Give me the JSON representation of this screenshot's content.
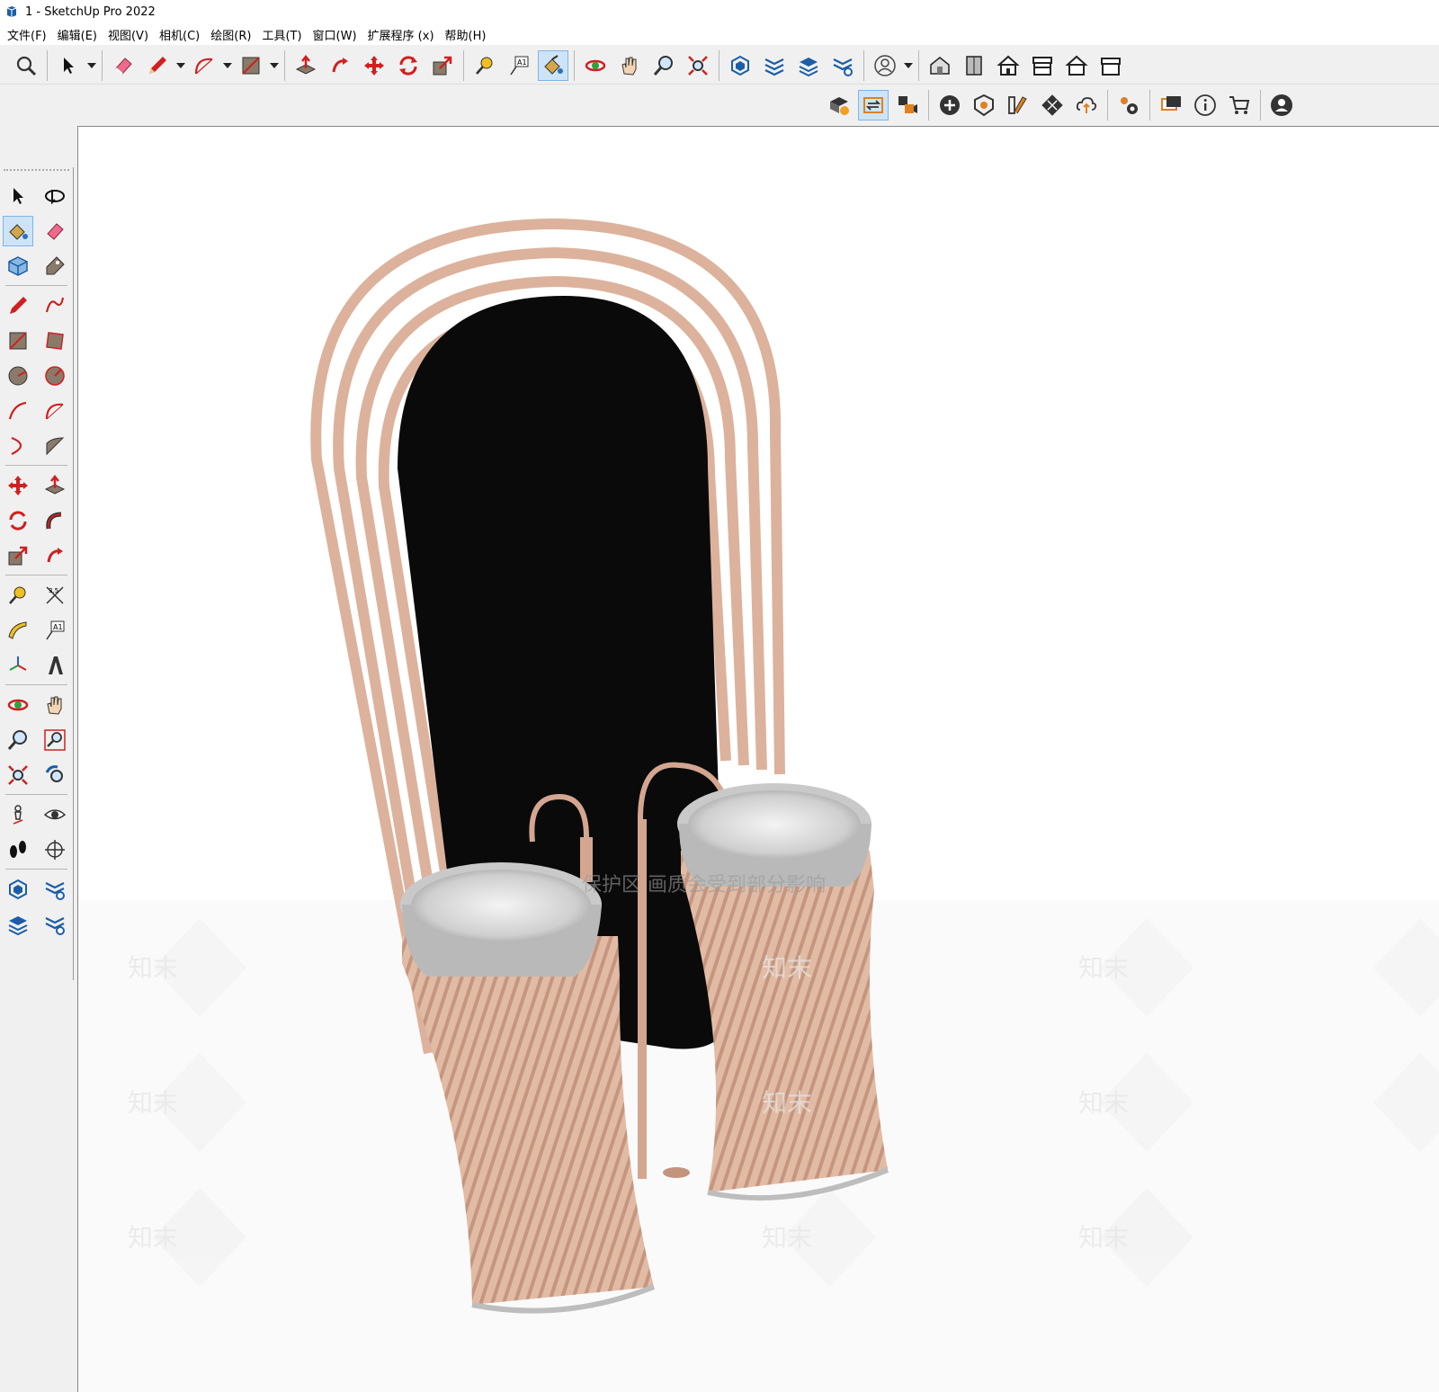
{
  "window": {
    "title": "1 - SketchUp Pro 2022"
  },
  "menu": [
    "文件(F)",
    "编辑(E)",
    "视图(V)",
    "相机(C)",
    "绘图(R)",
    "工具(T)",
    "窗口(W)",
    "扩展程序 (x)",
    "帮助(H)"
  ],
  "colors": {
    "accent": "#cde4f7",
    "model_rose": "#e0b8a2",
    "model_rose_dark": "#c4937c",
    "mirror": "#0a0a0a",
    "marble": "#d8d8d8"
  },
  "toolbar_top_icons": [
    "zoom-icon",
    "select-icon",
    "eraser-icon",
    "pencil-icon",
    "arc-icon",
    "rectangle-icon",
    "push-pull-icon",
    "follow-me-icon",
    "move-icon",
    "rotate-icon",
    "scale-icon",
    "tape-measure-icon",
    "text-icon",
    "paint-bucket-icon",
    "orbit-icon",
    "pan-icon",
    "zoom-tool-icon",
    "zoom-extents-icon",
    "warehouse-icon",
    "extension-warehouse-icon",
    "layer-icon",
    "settings-icon",
    "account-icon",
    "iso-view-icon",
    "top-view-icon",
    "front-view-icon",
    "right-view-icon",
    "back-view-icon",
    "left-view-icon"
  ],
  "toolbar_second_icons": [
    "section-icon",
    "transfer-icon",
    "video-icon",
    "add-icon",
    "style-icon",
    "materials-icon",
    "checker-icon",
    "cloud-icon",
    "gears-icon",
    "chat-icon",
    "info-icon",
    "cart-icon",
    "user-icon"
  ],
  "left_toolbar_icons": [
    [
      "select-icon",
      "orbit-icon"
    ],
    [
      "paint-bucket-icon",
      "eraser-icon"
    ],
    [
      "component-icon",
      "tag-icon"
    ],
    [
      "pencil-icon",
      "freehand-icon"
    ],
    [
      "rectangle-icon",
      "rotated-rectangle-icon"
    ],
    [
      "circle-icon",
      "polygon-icon"
    ],
    [
      "arc-icon",
      "two-point-arc-icon"
    ],
    [
      "three-point-arc-icon",
      "pie-icon"
    ],
    [
      "move-icon",
      "push-pull-icon"
    ],
    [
      "rotate-icon",
      "follow-me-icon"
    ],
    [
      "scale-icon",
      "offset-icon"
    ],
    [
      "tape-measure-icon",
      "dimension-icon"
    ],
    [
      "protractor-icon",
      "text-icon"
    ],
    [
      "axes-icon",
      "3d-text-icon"
    ],
    [
      "orbit-icon",
      "pan-icon"
    ],
    [
      "zoom-icon",
      "zoom-window-icon"
    ],
    [
      "zoom-extents-icon",
      "previous-view-icon"
    ],
    [
      "position-camera-icon",
      "look-around-icon"
    ],
    [
      "walk-icon",
      "section-plane-icon"
    ],
    [
      "warehouse-icon",
      "extension-icon"
    ],
    [
      "layer-icon",
      "settings-icon"
    ]
  ],
  "watermark": {
    "text": "知末",
    "banner": "保护区 画质会受到部分影响"
  }
}
